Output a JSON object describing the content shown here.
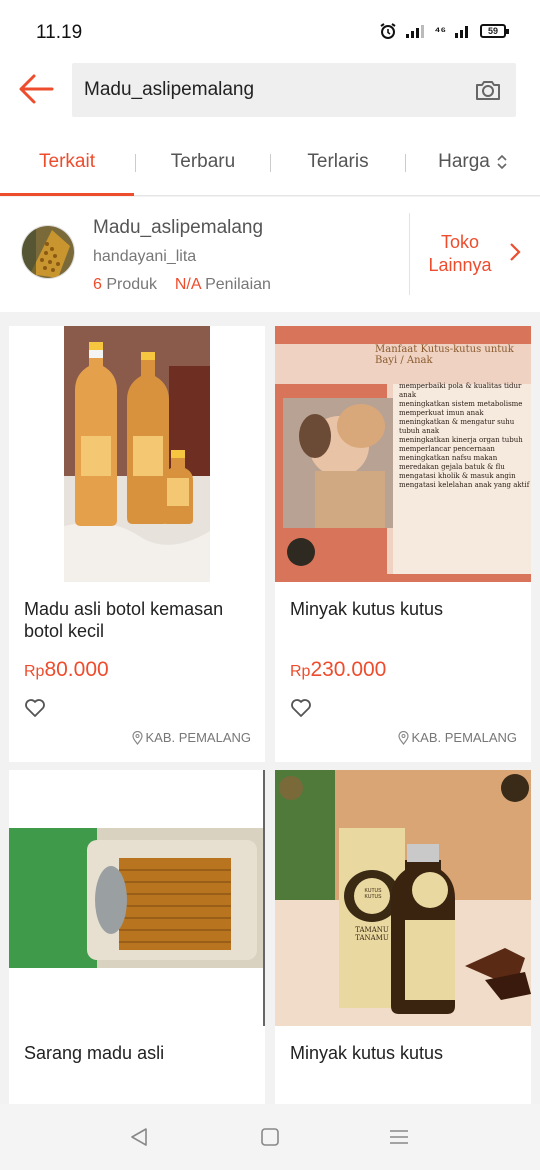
{
  "status": {
    "time": "11.19",
    "network": "⁴⁶",
    "battery": "59"
  },
  "search": {
    "query": "Madu_aslipemalang"
  },
  "tabs": [
    {
      "label": "Terkait"
    },
    {
      "label": "Terbaru"
    },
    {
      "label": "Terlaris"
    },
    {
      "label": "Harga"
    }
  ],
  "shop": {
    "name": "Madu_aslipemalang",
    "username": "handayani_lita",
    "products_count": "6",
    "products_label": "Produk",
    "rating_value": "N/A",
    "rating_label": "Penilaian",
    "more_label_line1": "Toko",
    "more_label_line2": "Lainnya"
  },
  "products": [
    {
      "title": "Madu asli botol kemasan botol kecil",
      "currency": "Rp",
      "price": "80.000",
      "location": "KAB. PEMALANG"
    },
    {
      "title": "Minyak kutus kutus",
      "currency": "Rp",
      "price": "230.000",
      "location": "KAB. PEMALANG"
    },
    {
      "title": "Sarang madu asli"
    },
    {
      "title": "Minyak kutus kutus"
    }
  ],
  "poster": {
    "heading": "Manfaat Kutus-kutus untuk Bayi / Anak",
    "bullets": [
      "memperbaiki pola & kualitas tidur anak",
      "meningkatkan sistem metabolisme",
      "memperkuat imun anak",
      "meningkatkan & mengatur suhu tubuh anak",
      "meningkatkan kinerja organ tubuh",
      "memperlancar pencernaan",
      "meningkatkan nafsu makan",
      "meredakan gejala batuk & flu",
      "mengatasi kholik & masuk angin",
      "mengatasi kelelahan anak yang aktif"
    ]
  },
  "bottle_labels": {
    "brand": "TAMANU TANAMU",
    "product": "KUTUS KUTUS"
  },
  "colors": {
    "accent": "#ee4d2d"
  },
  "icons": [
    "back-arrow-icon",
    "camera-icon",
    "sort-arrows-icon",
    "chevron-right-icon",
    "heart-icon",
    "location-pin-icon",
    "nav-back-icon",
    "nav-home-icon",
    "nav-menu-icon"
  ]
}
